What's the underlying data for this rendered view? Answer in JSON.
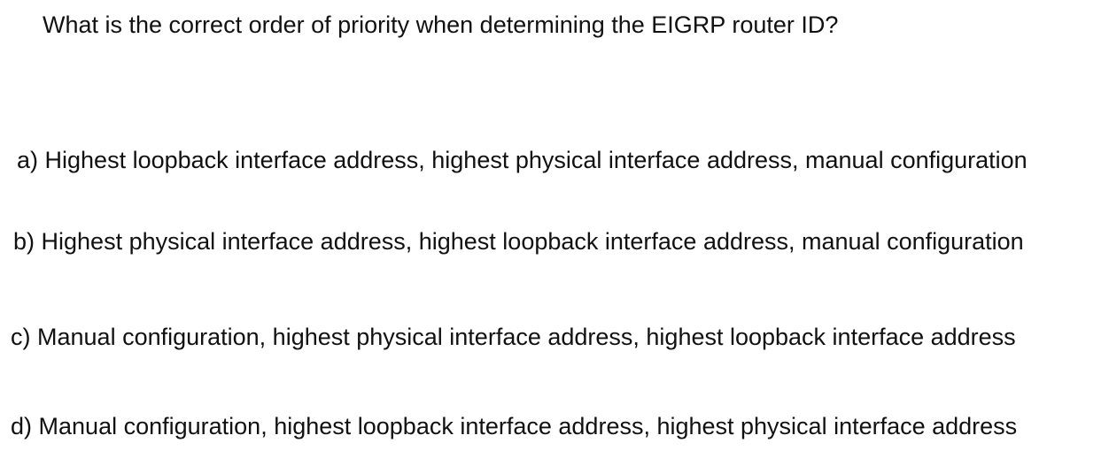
{
  "question": "What is the correct order of priority when determining the EIGRP router ID?",
  "options": [
    {
      "letter": "a)",
      "text": "Highest loopback interface address, highest physical interface address, manual configuration"
    },
    {
      "letter": "b)",
      "text": "Highest physical interface address, highest loopback interface address, manual configuration"
    },
    {
      "letter": "c)",
      "text": "Manual configuration, highest physical interface address, highest loopback interface address"
    },
    {
      "letter": "d)",
      "text": "Manual configuration, highest loopback interface address, highest physical interface address"
    }
  ]
}
